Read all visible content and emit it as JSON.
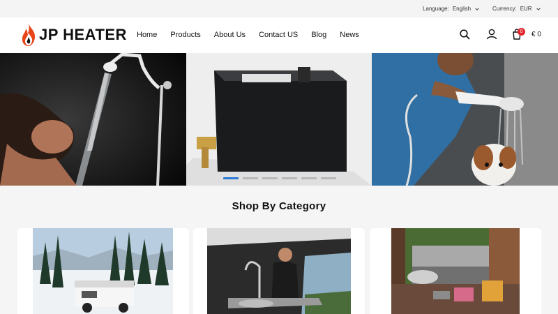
{
  "topbar": {
    "language_label": "Language:",
    "language_value": "English",
    "currency_label": "Currency:",
    "currency_value": "EUR"
  },
  "header": {
    "logo_text": "JP HEATER",
    "nav": [
      "Home",
      "Products",
      "About Us",
      "Contact US",
      "Blog",
      "News"
    ],
    "cart_count": "0",
    "cart_total": "€ 0"
  },
  "banner": {
    "slides": 6,
    "active_slide": 1
  },
  "category": {
    "title": "Shop By Category"
  },
  "colors": {
    "accent": "#2b79d6",
    "badge": "#e3262e",
    "logo_flame": "#e8451b"
  }
}
